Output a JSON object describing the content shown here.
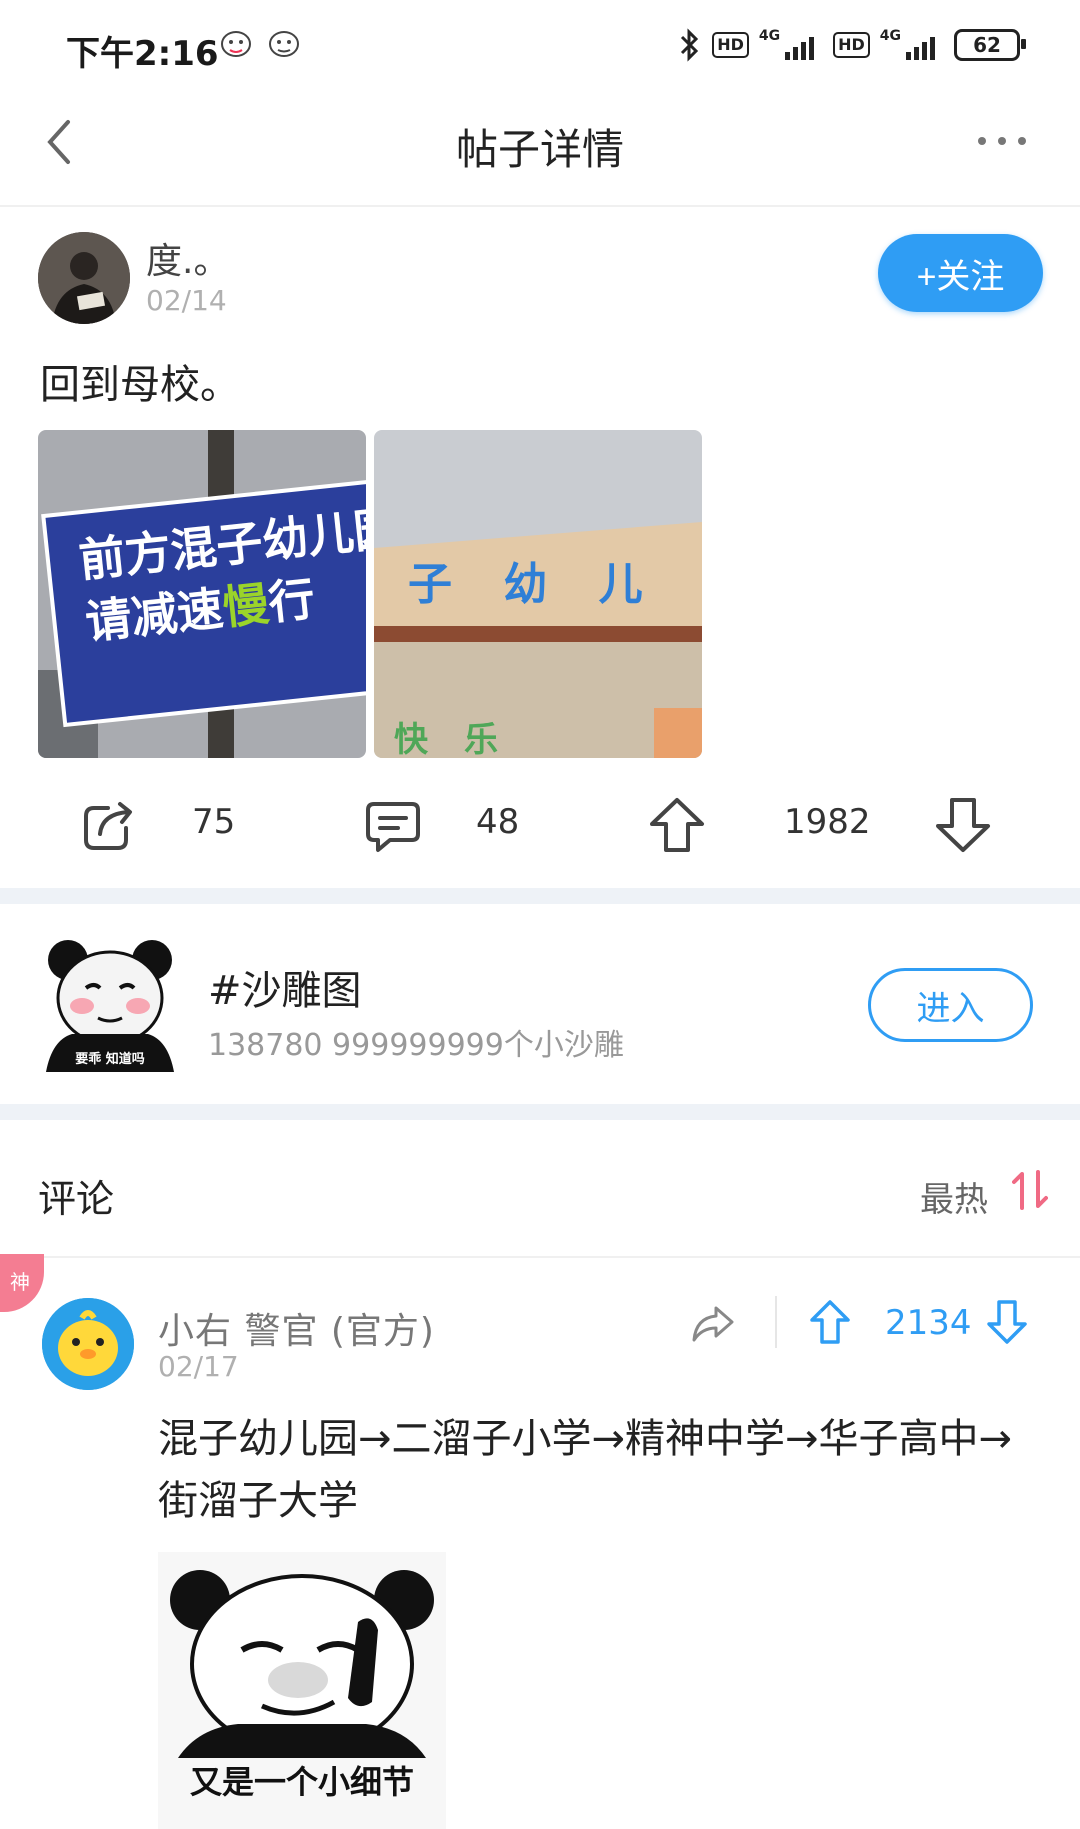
{
  "status_bar": {
    "time": "下午2:16",
    "network_1": "4G",
    "network_2": "4G",
    "hd_1": "HD",
    "hd_2": "HD",
    "battery": "62"
  },
  "nav": {
    "title": "帖子详情"
  },
  "post": {
    "username": "度.。",
    "date": "02/14",
    "follow_label": "+关注",
    "text": "回到母校。",
    "image_1_text_line1": "前方混子幼儿园",
    "image_1_text_line2a": "请减速",
    "image_1_text_line2b": "慢",
    "image_1_text_line2c": "行",
    "image_2_text": "子 幼 儿",
    "image_2_text_bottom": "快乐",
    "actions": {
      "share_count": "75",
      "comment_count": "48",
      "upvote_count": "1982"
    }
  },
  "topic": {
    "name": "#沙雕图",
    "stats": "138780 999999999个小沙雕",
    "enter_label": "进入",
    "icon_caption": "要乖 知道吗"
  },
  "comments_section": {
    "title": "评论",
    "sort_label": "最热"
  },
  "comment": {
    "badge": "神",
    "username": "小右 警官 (官方)",
    "date": "02/17",
    "vote_count": "2134",
    "text": "混子幼儿园→二溜子小学→精神中学→华子高中→街溜子大学",
    "meme_caption": "又是一个小细节"
  },
  "colors": {
    "accent_blue": "#2f9df4",
    "badge_pink": "#f47d92",
    "section_gap": "#eef2f7"
  }
}
